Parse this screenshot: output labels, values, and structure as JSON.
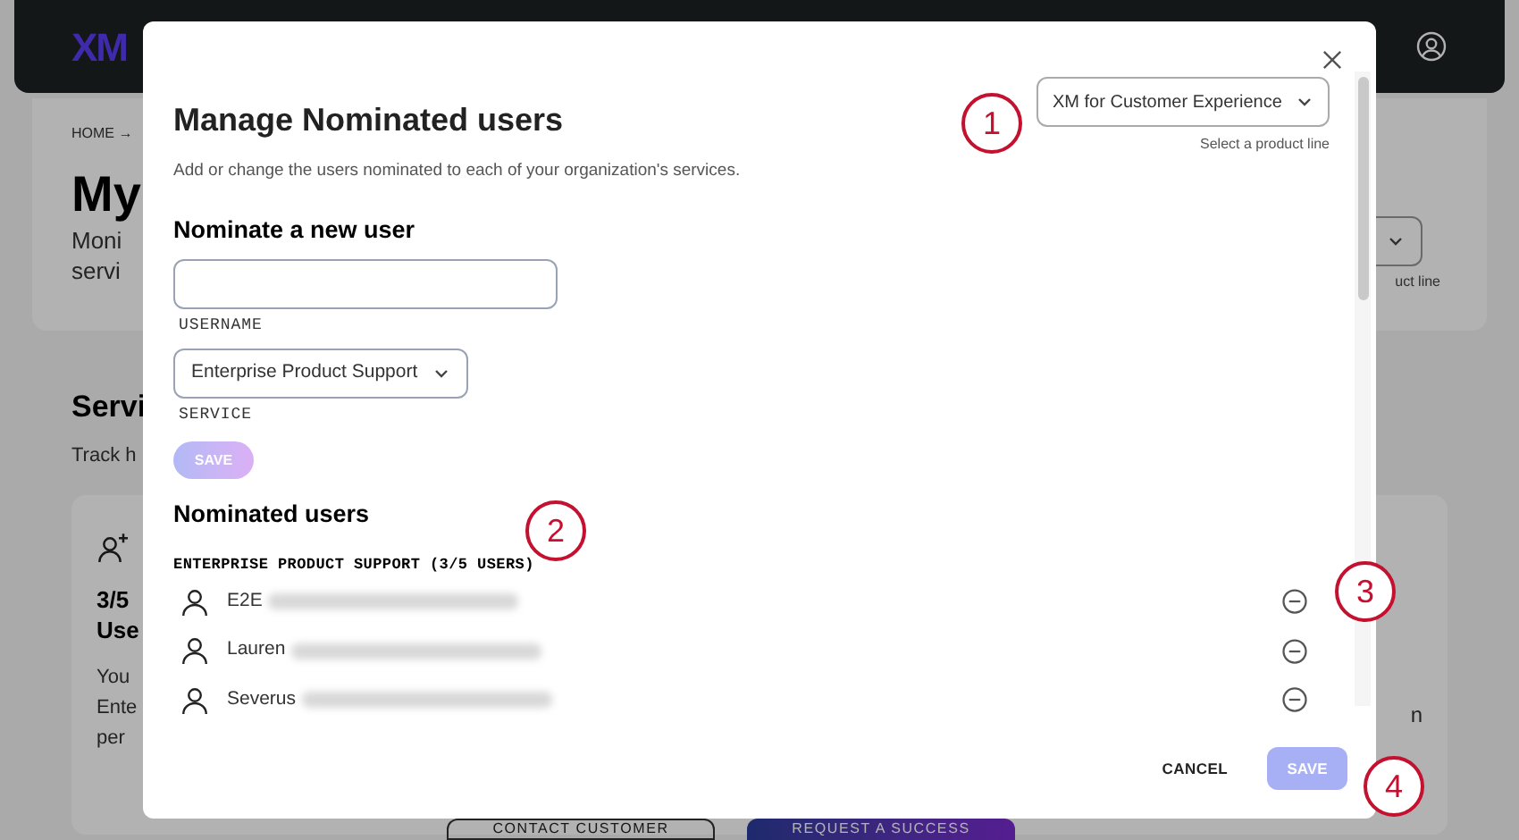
{
  "background": {
    "logo": "XM",
    "breadcrumb": "HOME →",
    "heading_fragment": "My",
    "intro_fragments": [
      "Moni",
      "servi"
    ],
    "product_line_fragment": "uct line",
    "section_heading_fragment": "Servi",
    "section_intro_fragment": "Track h",
    "card": {
      "count_fragment": "3/5",
      "label_fragment": "Use",
      "text_fragments": [
        "You",
        "Ente",
        "per"
      ],
      "right_fragment": "n"
    },
    "buttons": [
      {
        "label": "CONTACT CUSTOMER",
        "kind": "outline"
      },
      {
        "label": "REQUEST A SUCCESS",
        "kind": "filled"
      }
    ]
  },
  "dialog": {
    "title": "Manage Nominated users",
    "subtitle": "Add or change the users nominated to each of your organization's services.",
    "product_select": {
      "value": "XM for Customer Experience",
      "hint": "Select a product line"
    },
    "nominate": {
      "heading": "Nominate a new user",
      "username_label": "USERNAME",
      "service_select": {
        "value": "Enterprise Product Support"
      },
      "service_label": "SERVICE",
      "save": {
        "label": "SAVE",
        "disabled": true
      }
    },
    "nominated": {
      "heading": "Nominated users",
      "groups": [
        {
          "title": "ENTERPRISE PRODUCT SUPPORT (3/5 USERS)",
          "users": [
            {
              "name": "E2E"
            },
            {
              "name": "Lauren"
            },
            {
              "name": "Severus"
            }
          ]
        }
      ]
    },
    "footer": {
      "cancel": "CANCEL",
      "save": {
        "label": "SAVE",
        "disabled": true
      }
    }
  },
  "annotations": [
    "1",
    "2",
    "3",
    "4"
  ]
}
